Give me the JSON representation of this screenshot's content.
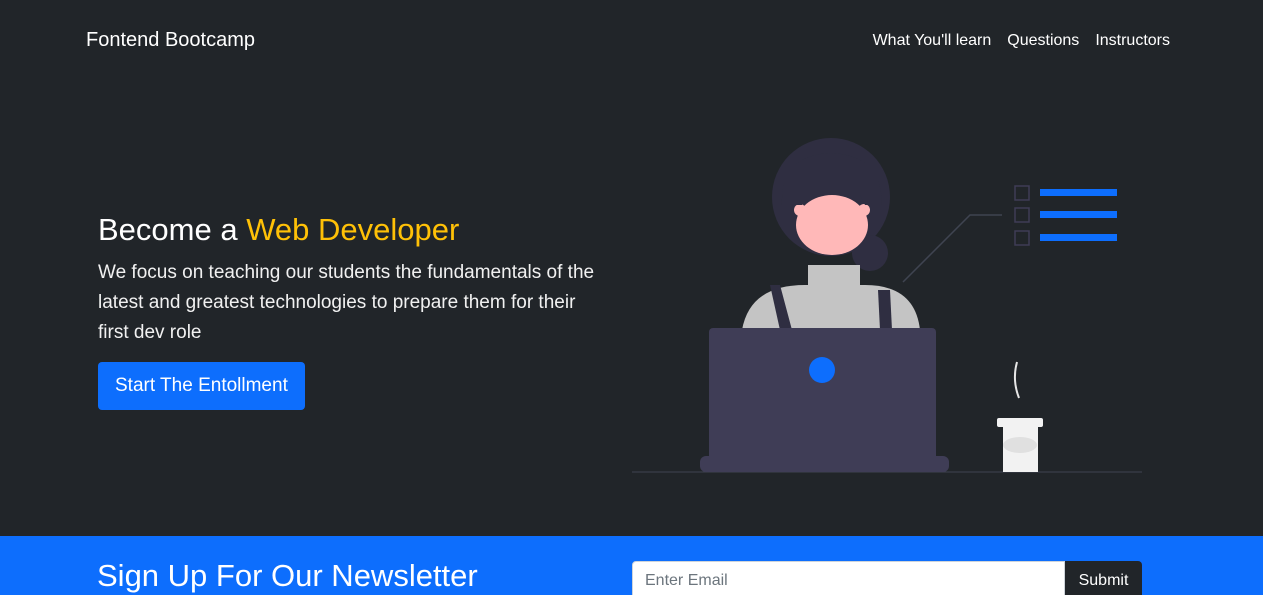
{
  "navbar": {
    "brand": "Fontend Bootcamp",
    "links": [
      "What You'll learn",
      "Questions",
      "Instructors"
    ]
  },
  "hero": {
    "title_prefix": "Become a ",
    "title_accent": "Web Developer",
    "lead": "We focus on teaching our students the fundamentals of the latest and greatest technologies to prepare them for their first dev role",
    "cta_label": "Start The Entollment"
  },
  "newsletter": {
    "title": "Sign Up For Our Newsletter",
    "email_placeholder": "Enter Email",
    "submit_label": "Submit"
  },
  "colors": {
    "background": "#212529",
    "primary": "#0d6efd",
    "accent": "#ffc107"
  }
}
